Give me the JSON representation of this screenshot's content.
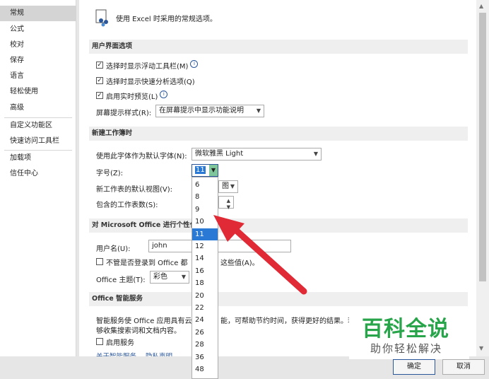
{
  "sidebar": {
    "items": [
      {
        "label": "常规",
        "active": true
      },
      {
        "label": "公式"
      },
      {
        "label": "校对"
      },
      {
        "label": "保存"
      },
      {
        "label": "语言"
      },
      {
        "label": "轻松使用"
      },
      {
        "label": "高级"
      },
      {
        "label": "自定义功能区"
      },
      {
        "label": "快速访问工具栏"
      },
      {
        "label": "加载项"
      },
      {
        "label": "信任中心"
      }
    ]
  },
  "header": {
    "title": "使用 Excel 时采用的常规选项。"
  },
  "sections": {
    "ui": {
      "title": "用户界面选项",
      "mini_toolbar": "选择时显示浮动工具栏(M)",
      "quick_analysis": "选择时显示快速分析选项(Q)",
      "live_preview": "启用实时预览(L)",
      "screentip_label": "屏幕提示样式(R):",
      "screentip_value": "在屏幕提示中显示功能说明"
    },
    "workbook": {
      "title": "新建工作簿时",
      "font_label": "使用此字体作为默认字体(N):",
      "font_value": "微软雅黑 Light",
      "size_label": "字号(Z):",
      "size_value": "11",
      "view_label": "新工作表的默认视图(V):",
      "view_value": "图",
      "sheets_label": "包含的工作表数(S):"
    },
    "personalize": {
      "title_visible": "对 Microsoft Office 进行个性化",
      "username_label": "用户名(U):",
      "username_value": "john",
      "always_use": "不管是否登录到 Office 都",
      "always_use_tail": "这些值(A)。",
      "theme_label": "Office 主题(T):",
      "theme_value": "彩色"
    },
    "intelligent": {
      "title": "Office 智能服务",
      "desc_1a": "智能服务使 Office 应用具有云",
      "desc_1b": "能，可帮助节约时间，获得更好的结果。若",
      "desc_2": "够收集搜索词和文档内容。",
      "enable": "启用服务",
      "about": "关于智能服务",
      "privacy": "隐私声明"
    }
  },
  "dropdown": {
    "options": [
      "6",
      "8",
      "9",
      "10",
      "11",
      "12",
      "14",
      "16",
      "18",
      "20",
      "22",
      "24",
      "26",
      "28",
      "36",
      "48"
    ],
    "selected": "11"
  },
  "footer": {
    "ok": "确定",
    "cancel": "取消"
  },
  "watermark": {
    "title": "百科全说",
    "subtitle": "助你轻松解决"
  },
  "colors": {
    "accent": "#2b579a",
    "selection": "#2a7ad5",
    "arrow": "#e02a36",
    "watermark": "#28a54a"
  }
}
